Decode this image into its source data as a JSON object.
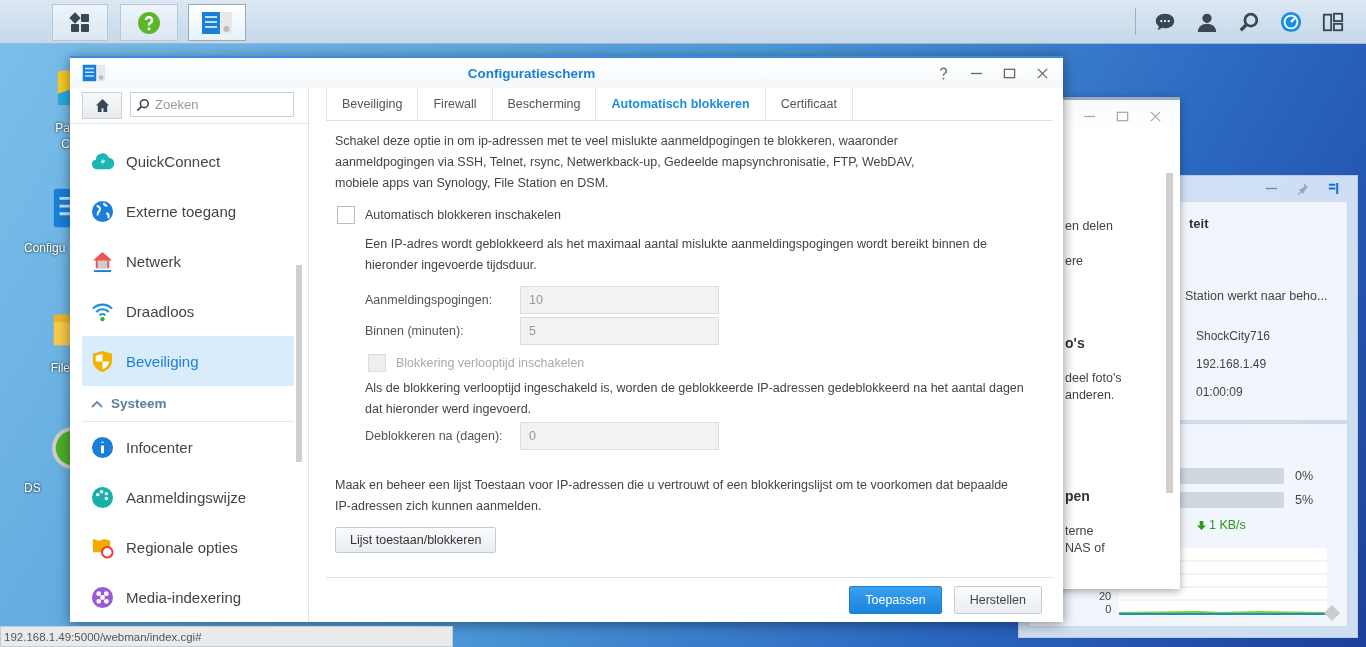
{
  "taskbar": {
    "left_buttons": [
      {
        "kind": "main-menu",
        "selected": false
      },
      {
        "kind": "help",
        "selected": false
      },
      {
        "kind": "control-panel",
        "selected": true
      }
    ],
    "right_buttons": [
      {
        "kind": "chat"
      },
      {
        "kind": "user"
      },
      {
        "kind": "search"
      },
      {
        "kind": "dashboard"
      },
      {
        "kind": "widgets"
      }
    ]
  },
  "desktop_icons": [
    {
      "kind": "package",
      "label_lines": [
        "Pa",
        "C"
      ]
    },
    {
      "kind": "control-panel",
      "label_lines": [
        "Configu"
      ]
    },
    {
      "kind": "folder",
      "label_lines": [
        "File"
      ]
    },
    {
      "kind": "dsm",
      "label_lines": [
        "DS"
      ]
    }
  ],
  "widget_panel": {
    "status_card": {
      "title": "teit",
      "status": "Station werkt naar beho...",
      "values": [
        "ShockCity716",
        "192.168.1.49",
        "01:00:09"
      ]
    },
    "resource_card": {
      "readings": [
        "0%",
        "5%"
      ],
      "speed": "1 KB/s",
      "chart_ticks": [
        "20",
        "0"
      ]
    }
  },
  "back_window": {
    "lines": [
      {
        "text": "en delen",
        "bold": false
      },
      {
        "text": "ere",
        "bold": false
      },
      {
        "text": "o's",
        "bold": true
      },
      {
        "text": "deel foto's",
        "bold": false
      },
      {
        "text": "anderen.",
        "bold": false
      },
      {
        "text": "pen",
        "bold": true
      },
      {
        "text": "terne",
        "bold": false
      },
      {
        "text": "NAS of",
        "bold": false
      }
    ]
  },
  "main_window": {
    "title": "Configuratiescherm",
    "sidebar": {
      "search": {
        "placeholder": "Zoeken"
      },
      "items": [
        {
          "kind": "item",
          "label": "QuickConnect",
          "selected": false
        },
        {
          "kind": "item",
          "label": "Externe toegang",
          "selected": false
        },
        {
          "kind": "item",
          "label": "Netwerk",
          "selected": false
        },
        {
          "kind": "item",
          "label": "Draadloos",
          "selected": false
        },
        {
          "kind": "item",
          "label": "Beveiliging",
          "selected": true
        },
        {
          "kind": "header",
          "label": "Systeem",
          "expanded": true
        },
        {
          "kind": "item",
          "label": "Infocenter",
          "selected": false
        },
        {
          "kind": "item",
          "label": "Aanmeldingswijze",
          "selected": false
        },
        {
          "kind": "item",
          "label": "Regionale opties",
          "selected": false
        },
        {
          "kind": "item",
          "label": "Media-indexering",
          "selected": false
        }
      ]
    },
    "tabs": [
      {
        "label": "Beveiliging",
        "selected": false
      },
      {
        "label": "Firewall",
        "selected": false
      },
      {
        "label": "Bescherming",
        "selected": false
      },
      {
        "label": "Automatisch blokkeren",
        "selected": true
      },
      {
        "label": "Certificaat",
        "selected": false
      }
    ],
    "intro": "Schakel deze optie in om ip-adressen met te veel mislukte aanmeldpogingen te blokkeren, waaronder aanmeldpogingen via SSH, Telnet, rsync, Netwerkback-up, Gedeelde mapsynchronisatie, FTP, WebDAV, mobiele apps van Synology, File Station en DSM.",
    "enable_checkbox": {
      "label": "Automatisch blokkeren inschakelen",
      "checked": false,
      "disabled": false
    },
    "block_description": "Een IP-adres wordt geblokkeerd als het maximaal aantal mislukte aanmeldingspogingen wordt bereikt binnen de hieronder ingevoerde tijdsduur.",
    "block_fields": [
      {
        "label": "Aanmeldingspogingen:",
        "value": "10",
        "disabled": true
      },
      {
        "label": "Binnen (minuten):",
        "value": "5",
        "disabled": true
      }
    ],
    "expiry_checkbox": {
      "label": "Blokkering verlooptijd inschakelen",
      "checked": false,
      "disabled": true
    },
    "expiry_description": "Als de blokkering verlooptijd ingeschakeld is, worden de geblokkeerde IP-adressen gedeblokkeerd na het aantal dagen dat hieronder werd ingevoerd.",
    "expiry_field": {
      "label": "Deblokkeren na (dagen):",
      "value": "0",
      "disabled": true
    },
    "allowlist_text": "Maak en beheer een lijst Toestaan voor IP-adressen die u vertrouwt of een blokkeringslijst om te voorkomen dat bepaalde IP-adressen zich kunnen aanmelden.",
    "allowlist_button": "Lijst toestaan/blokkeren",
    "footer_buttons": [
      {
        "label": "Toepassen",
        "kind": "primary"
      },
      {
        "label": "Herstellen",
        "kind": "secondary"
      }
    ]
  },
  "status_bar": {
    "url": "192.168.1.49:5000/webman/index.cgi#"
  }
}
